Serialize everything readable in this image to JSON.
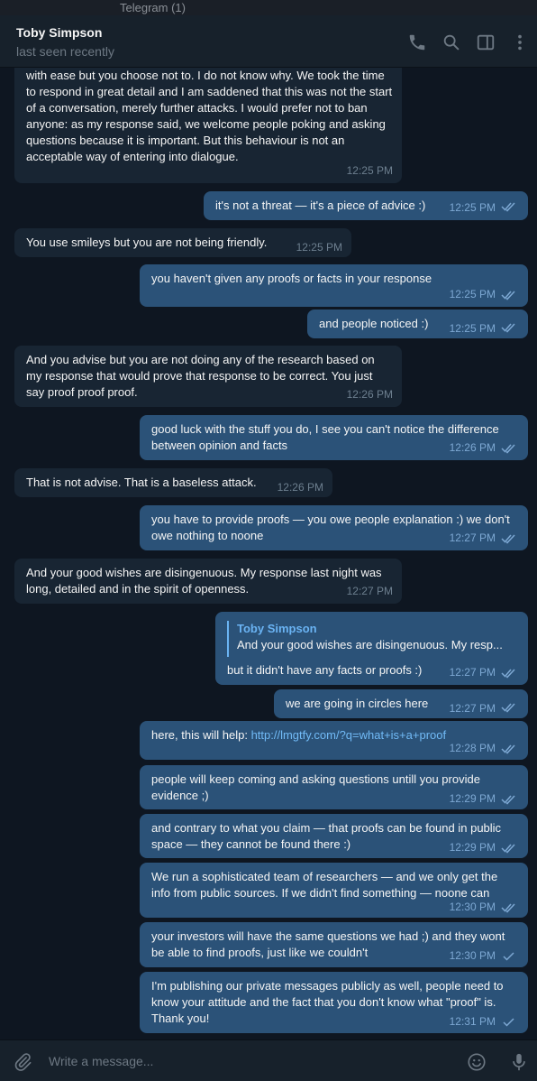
{
  "window": {
    "title": "Telegram (1)"
  },
  "header": {
    "contact_name": "Toby Simpson",
    "status": "last seen recently",
    "icons": [
      "phone-icon",
      "search-icon",
      "sidebar-toggle-icon",
      "more-icon"
    ]
  },
  "colors": {
    "background": "#0e1621",
    "incoming_bubble": "#182533",
    "outgoing_bubble": "#2b5278",
    "accent": "#6ab3f3",
    "link": "#71baf6"
  },
  "messages": [
    {
      "direction": "in",
      "text": "with ease but you choose not to. I do not know why. We took the time to respond in great detail and I am saddened that this was not the start of a conversation, merely further attacks. I would prefer not to ban anyone: as my response said, we welcome people poking and asking questions because it is important. But this behaviour is not an acceptable way of entering into dialogue.",
      "time": "12:25 PM"
    },
    {
      "direction": "out",
      "text": "it's not a threat — it's a piece of advice :)",
      "time": "12:25 PM",
      "status": "read"
    },
    {
      "direction": "in",
      "text": "You use smileys but you are not being friendly.",
      "time": "12:25 PM"
    },
    {
      "direction": "out",
      "text": "you haven't given any proofs or facts in your response",
      "time": "12:25 PM",
      "status": "read"
    },
    {
      "direction": "out",
      "text": "and people noticed :)",
      "time": "12:25 PM",
      "status": "read"
    },
    {
      "direction": "in",
      "text": "And you advise but you are not doing any of the research based on my response that would prove that response to be correct. You just say proof proof proof.",
      "time": "12:26 PM"
    },
    {
      "direction": "out",
      "text": "good luck with the stuff you do, I see you can't notice the difference between opinion and facts",
      "time": "12:26 PM",
      "status": "read"
    },
    {
      "direction": "in",
      "text": "That is not advise. That is a baseless attack.",
      "time": "12:26 PM"
    },
    {
      "direction": "out",
      "text": "you have to provide proofs — you owe people explanation :) we don't owe nothing to noone",
      "time": "12:27 PM",
      "status": "read"
    },
    {
      "direction": "in",
      "text": "And your good wishes are disingenuous. My response last night was long, detailed and in the spirit of openness.",
      "time": "12:27 PM"
    },
    {
      "direction": "out",
      "reply_name": "Toby Simpson",
      "reply_text": "And your good wishes are disingenuous. My resp...",
      "text": "but it didn't have any facts or proofs :)",
      "time": "12:27 PM",
      "status": "read"
    },
    {
      "direction": "out",
      "text": "we are going in circles here",
      "time": "12:27 PM",
      "status": "read"
    },
    {
      "direction": "out",
      "text": "here, this will help: ",
      "link": "http://lmgtfy.com/?q=what+is+a+proof",
      "time": "12:28 PM",
      "status": "read"
    },
    {
      "direction": "out",
      "text": "people will keep coming and asking questions untill you provide evidence ;)",
      "time": "12:29 PM",
      "status": "read"
    },
    {
      "direction": "out",
      "text": "and contrary to what you claim — that proofs can be found in public space — they cannot be found there :)",
      "time": "12:29 PM",
      "status": "read"
    },
    {
      "direction": "out",
      "text": "We run a sophisticated team of researchers — and we only get the info from public sources. If we didn't find something — noone can",
      "time": "12:30 PM",
      "status": "read"
    },
    {
      "direction": "out",
      "text": "your investors will have the same questions we had ;) and they wont be able to find proofs, just like we couldn't",
      "time": "12:30 PM",
      "status": "sent"
    },
    {
      "direction": "out",
      "text": "I'm publishing our private messages publicly as well, people need to know your attitude and the fact that you don't know what \"proof\" is. Thank you!",
      "time": "12:31 PM",
      "status": "sent"
    }
  ],
  "composer": {
    "placeholder": "Write a message...",
    "icons": [
      "attach-icon",
      "emoji-icon",
      "microphone-icon"
    ]
  }
}
